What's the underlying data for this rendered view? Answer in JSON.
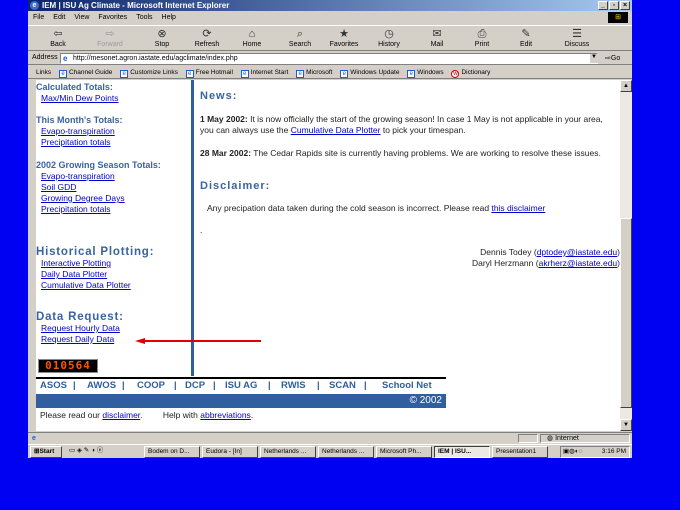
{
  "window": {
    "title": "IEM | ISU Ag Climate - Microsoft Internet Explorer",
    "menu": [
      "File",
      "Edit",
      "View",
      "Favorites",
      "Tools",
      "Help"
    ]
  },
  "toolbar": {
    "back": "Back",
    "forward": "Forward",
    "stop": "Stop",
    "refresh": "Refresh",
    "home": "Home",
    "search": "Search",
    "favorites": "Favorites",
    "history": "History",
    "mail": "Mail",
    "print": "Print",
    "edit": "Edit",
    "discuss": "Discuss"
  },
  "address": {
    "label": "Address",
    "url": "http://mesonet.agron.iastate.edu/agclimate/index.php",
    "go": "Go"
  },
  "links": {
    "label": "Links",
    "items": [
      "Channel Guide",
      "Customize Links",
      "Free Hotmail",
      "Internet Start",
      "Microsoft",
      "Windows Update",
      "Windows",
      "Dictionary"
    ]
  },
  "sidebar": {
    "calculated_heading": "Calculated Totals:",
    "calculated_links": [
      "Max/Min Dew Points"
    ],
    "month_heading": "This Month's Totals:",
    "month_links": [
      "Evapo-transpiration",
      "Precipitation totals"
    ],
    "season_heading": "2002 Growing Season Totals:",
    "season_links": [
      "Evapo-transpiration",
      "Soil GDD",
      "Growing Degree Days",
      "Precipitation totals"
    ],
    "historical_heading": "Historical Plotting:",
    "historical_links": [
      "Interactive Plotting",
      "Daily Data Plotter",
      "Cumulative Data Plotter"
    ],
    "request_heading": "Data Request:",
    "request_links": [
      "Request Hourly Data",
      "Request Daily Data"
    ],
    "counter": "010564"
  },
  "news": {
    "heading": "News:",
    "item1_date": "1 May 2002:",
    "item1_text_a": " It is now officially the start of the growing season! In case 1 May is not applicable in your area, you can always use the ",
    "item1_link": "Cumulative Data Plotter",
    "item1_text_b": " to pick your timespan.",
    "item2_date": "28 Mar 2002:",
    "item2_text": " The Cedar Rapids site is currently having problems. We are working to resolve these issues."
  },
  "disclaimer": {
    "heading": "Disclaimer:",
    "text": "Any precipation data taken during the cold season is incorrect. Please read ",
    "link": "this disclaimer",
    "dot": "."
  },
  "contacts": {
    "name1": "Dennis Todey (",
    "email1": "dptodey@iastate.edu",
    "close1": ")",
    "name2": "Daryl Herzmann (",
    "email2": "akrherz@iastate.edu",
    "close2": ")"
  },
  "navbar": {
    "items": [
      "ASOS",
      "AWOS",
      "COOP",
      "DCP",
      "ISU AG",
      "RWIS",
      "SCAN",
      "School Net"
    ],
    "copyright": "© 2002"
  },
  "footer": {
    "text1": "Please read our ",
    "link1": "disclaimer",
    "text2": ".",
    "text3": "Help with ",
    "link2": "abbreviations",
    "text4": "."
  },
  "status": {
    "icon": "e",
    "zone": "Internet"
  },
  "taskbar": {
    "start": "Start",
    "tasks": [
      "Bodem on D...",
      "Eudora - [In]",
      "Netherlands ...",
      "Netherlands ...",
      "Microsoft Ph...",
      "IEM | ISU...",
      "Presentation1"
    ],
    "clock": "3:16 PM"
  },
  "colors": {
    "desktop": "#0000f2",
    "heading": "#3a63a0",
    "accent_bar": "#2f5f9e",
    "arrow": "#e00000"
  }
}
